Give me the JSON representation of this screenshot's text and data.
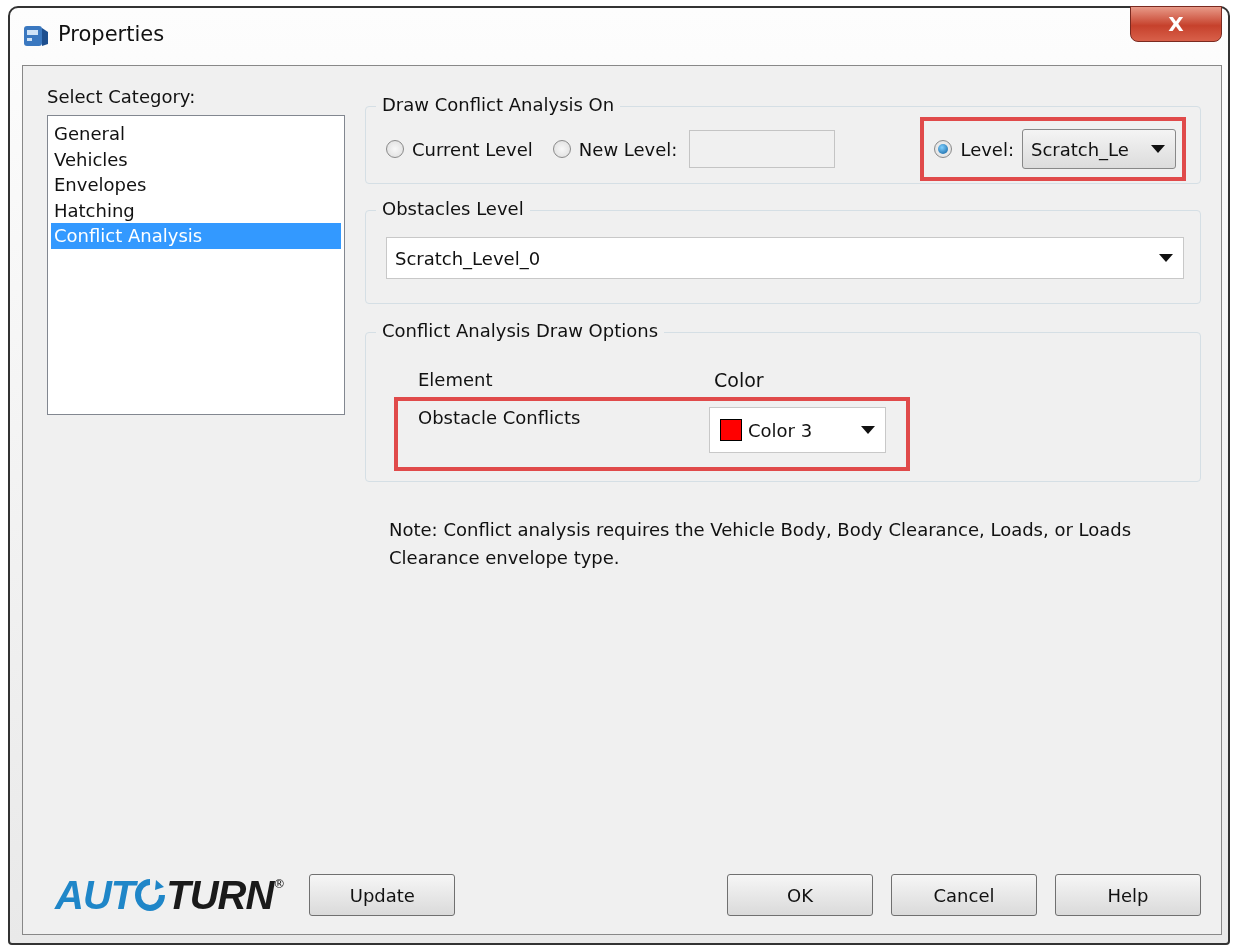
{
  "window": {
    "title": "Properties",
    "close": "X"
  },
  "category": {
    "label": "Select Category:",
    "items": [
      {
        "label": "General",
        "selected": false
      },
      {
        "label": "Vehicles",
        "selected": false
      },
      {
        "label": "Envelopes",
        "selected": false
      },
      {
        "label": "Hatching",
        "selected": false
      },
      {
        "label": "Conflict Analysis",
        "selected": true
      }
    ]
  },
  "draw_on": {
    "title": "Draw Conflict Analysis On",
    "options": [
      {
        "kind": "plain",
        "label": "Current Level",
        "selected": false
      },
      {
        "kind": "field",
        "label": "New Level:",
        "selected": false
      },
      {
        "kind": "combo",
        "label": "Level:",
        "selected": true,
        "value": "Scratch_Le",
        "highlighted": true
      }
    ]
  },
  "obstacles": {
    "title": "Obstacles Level",
    "value": "Scratch_Level_0"
  },
  "draw_options": {
    "title": "Conflict Analysis Draw Options",
    "columns": [
      "Element",
      "Color"
    ],
    "rows": [
      {
        "element": "Obstacle Conflicts",
        "color_name": "Color 3",
        "color": "#ff0000",
        "highlighted": true
      }
    ]
  },
  "note": "Note: Conflict analysis requires the Vehicle Body, Body Clearance, Loads, or Loads Clearance envelope type.",
  "logo": {
    "before": "AUT",
    "after": "TURN",
    "mark": "®"
  },
  "buttons": [
    {
      "label": "Update",
      "kind": "left"
    },
    {
      "label": "OK",
      "kind": "right"
    },
    {
      "label": "Cancel",
      "kind": "right"
    },
    {
      "label": "Help",
      "kind": "right"
    }
  ]
}
